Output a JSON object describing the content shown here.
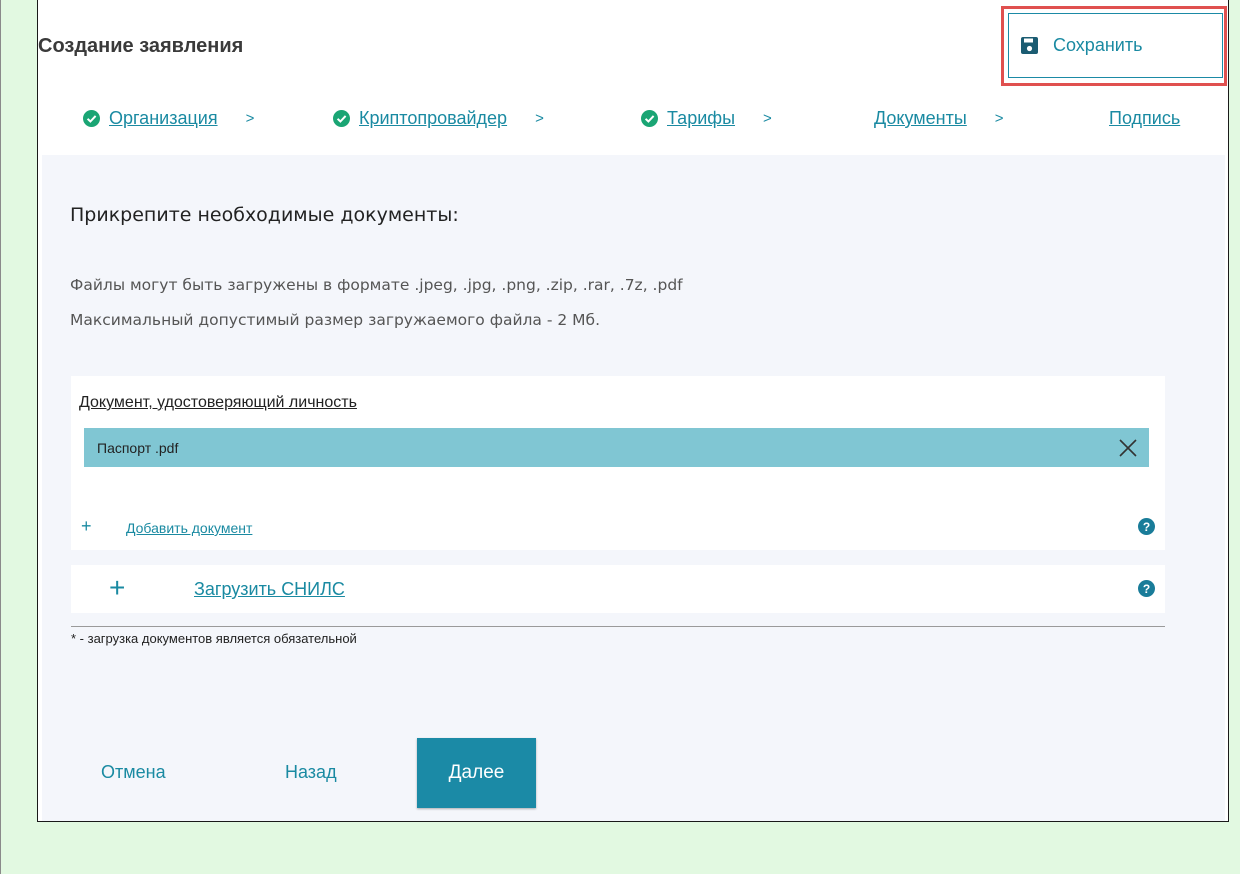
{
  "header": {
    "title": "Создание заявления",
    "save_label": "Сохранить"
  },
  "steps": [
    {
      "label": "Организация",
      "completed": true,
      "separator": ">"
    },
    {
      "label": "Криптопровайдер",
      "completed": true,
      "separator": ">"
    },
    {
      "label": "Тарифы",
      "completed": true,
      "separator": ">"
    },
    {
      "label": "Документы",
      "completed": false,
      "separator": ">"
    },
    {
      "label": "Подпись",
      "completed": false,
      "separator": ""
    }
  ],
  "main": {
    "heading": "Прикрепите необходимые документы:",
    "hint_formats": "Файлы могут быть загружены в формате .jpeg, .jpg, .png, .zip, .rar, .7z, .pdf",
    "hint_size": "Максимальный допустимый размер загружаемого файла - 2 Мб.",
    "identity_card": {
      "title": "Документ, удостоверяющий личность",
      "file_name": "Паспорт .pdf",
      "add_plus": "+",
      "add_label": "Добавить документ",
      "help": "?"
    },
    "snils_card": {
      "plus": "+",
      "label": "Загрузить СНИЛС",
      "help": "?"
    },
    "footnote": "* - загрузка документов является обязательной"
  },
  "footer": {
    "cancel_label": "Отмена",
    "back_label": "Назад",
    "next_label": "Далее"
  },
  "colors": {
    "accent": "#1b8aa6",
    "file_row": "#80c6d3",
    "highlight": "#e0504f",
    "check": "#1aa574",
    "page_bg": "#e2f9e1"
  }
}
